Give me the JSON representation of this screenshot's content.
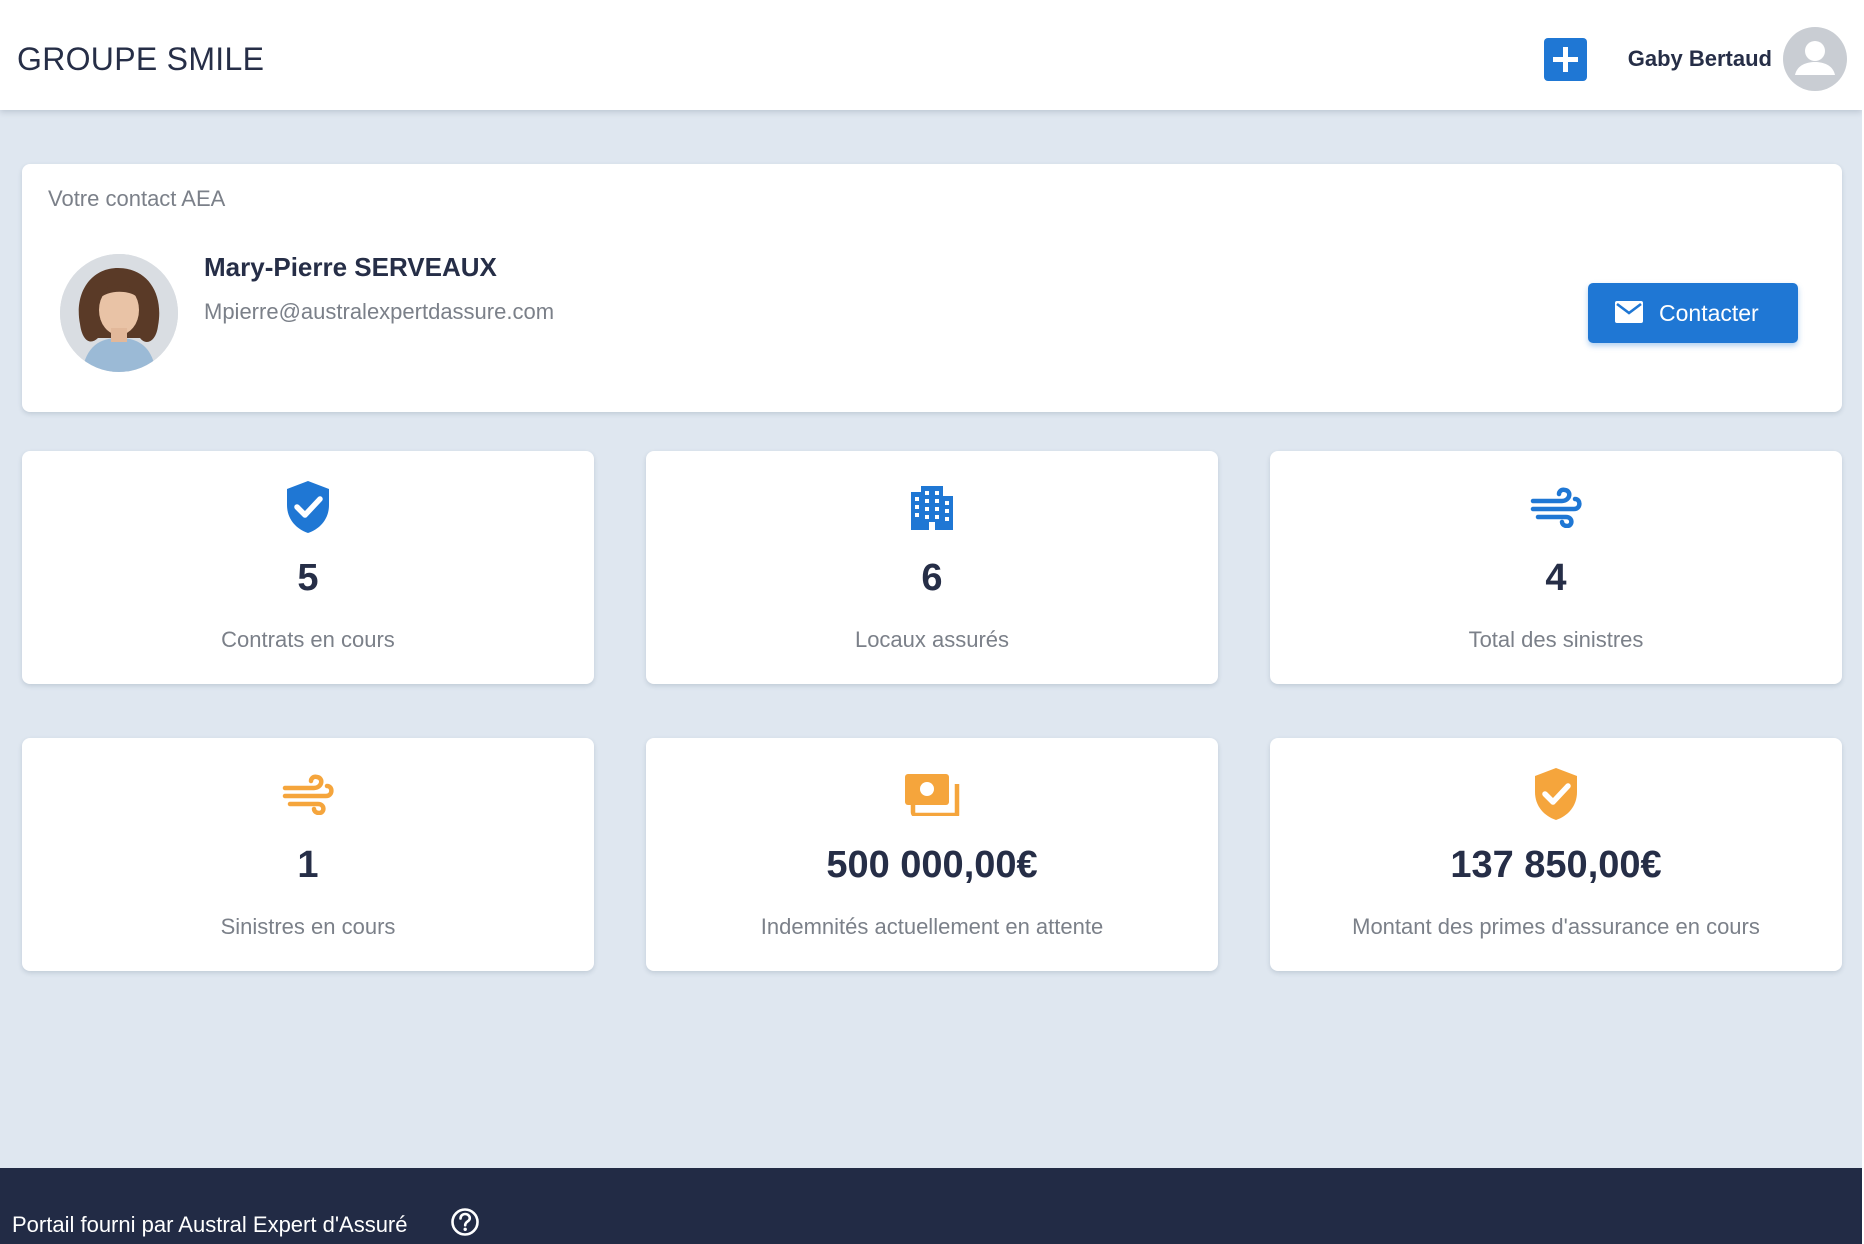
{
  "header": {
    "brand": "GROUPE SMILE",
    "user_name": "Gaby Bertaud"
  },
  "contact": {
    "heading": "Votre contact AEA",
    "name": "Mary-Pierre SERVEAUX",
    "email": "Mpierre@australexpertdassure.com",
    "button_label": "Contacter"
  },
  "stats": [
    {
      "icon": "shield-check-icon",
      "value": "5",
      "label": "Contrats en cours",
      "color": "#1f77d4"
    },
    {
      "icon": "building-icon",
      "value": "6",
      "label": "Locaux assurés",
      "color": "#1f77d4"
    },
    {
      "icon": "wind-icon",
      "value": "4",
      "label": "Total des sinistres",
      "color": "#1f77d4"
    },
    {
      "icon": "wind-icon",
      "value": "1",
      "label": "Sinistres en cours",
      "color": "#f5a53c"
    },
    {
      "icon": "cash-icon",
      "value": "500 000,00€",
      "label": "Indemnités actuellement en attente",
      "color": "#f5a53c"
    },
    {
      "icon": "shield-check-icon",
      "value": "137 850,00€",
      "label": "Montant des primes d'assurance en cours",
      "color": "#f5a53c"
    }
  ],
  "footer": {
    "text": "Portail fourni par Austral Expert d'Assuré"
  },
  "colors": {
    "primary": "#1f77d4",
    "accent": "#f5a53c",
    "background": "#dfe7f0",
    "footer": "#222b45",
    "text_dark": "#262e47",
    "text_muted": "#7b8089"
  }
}
